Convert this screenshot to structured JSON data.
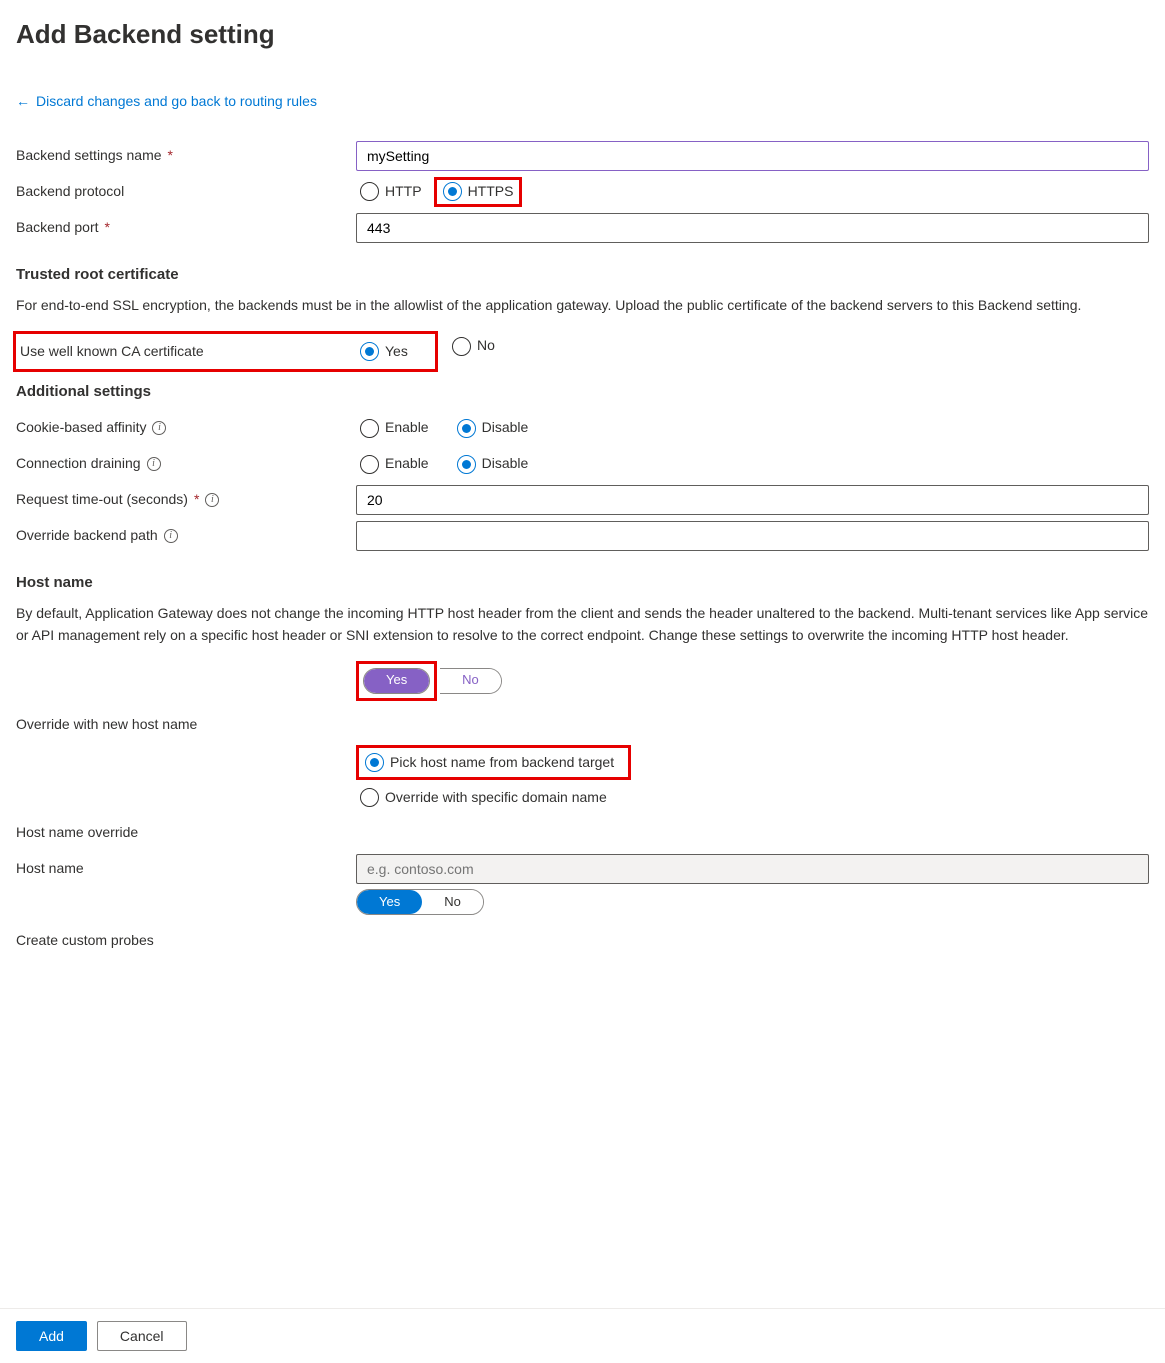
{
  "header": {
    "title": "Add Backend setting",
    "back_link": "Discard changes and go back to routing rules"
  },
  "fields": {
    "name_label": "Backend settings name",
    "name_value": "mySetting",
    "protocol_label": "Backend protocol",
    "protocol_http": "HTTP",
    "protocol_https": "HTTPS",
    "port_label": "Backend port",
    "port_value": "443"
  },
  "trusted": {
    "heading": "Trusted root certificate",
    "desc": "For end-to-end SSL encryption, the backends must be in the allowlist of the application gateway. Upload the public certificate of the backend servers to this Backend setting.",
    "ca_label": "Use well known CA certificate",
    "yes": "Yes",
    "no": "No"
  },
  "additional": {
    "heading": "Additional settings",
    "cookie_label": "Cookie-based affinity",
    "connection_label": "Connection draining",
    "enable": "Enable",
    "disable": "Disable",
    "timeout_label": "Request time-out (seconds)",
    "timeout_value": "20",
    "override_path_label": "Override backend path"
  },
  "hostname": {
    "heading": "Host name",
    "desc": "By default, Application Gateway does not change the incoming HTTP host header from the client and sends the header unaltered to the backend. Multi-tenant services like App service or API management rely on a specific host header or SNI extension to resolve to the correct endpoint. Change these settings to overwrite the incoming HTTP host header.",
    "override_toggle_yes": "Yes",
    "override_toggle_no": "No",
    "override_label": "Override with new host name",
    "pick_backend": "Pick host name from backend target",
    "specific_domain": "Override with specific domain name",
    "hostname_override_label": "Host name override",
    "hostname_label": "Host name",
    "hostname_placeholder": "e.g. contoso.com",
    "probes_label": "Create custom probes",
    "probes_yes": "Yes",
    "probes_no": "No"
  },
  "footer": {
    "add": "Add",
    "cancel": "Cancel"
  }
}
